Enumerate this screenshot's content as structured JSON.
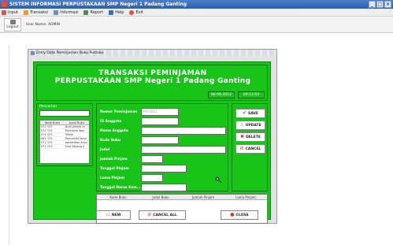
{
  "window": {
    "title": "SISTEM INFORMASI PERPUSTAKAAN SMP Negeri 1 Padang Ganting",
    "buttons": [
      "_",
      "□",
      "×"
    ]
  },
  "menu": {
    "items": [
      {
        "label": "Input",
        "icon": "input-icon",
        "color": "#d9534f"
      },
      {
        "label": "Transaksi",
        "icon": "transaksi-icon",
        "color": "#e0a030"
      },
      {
        "label": "Informasi",
        "icon": "informasi-icon",
        "color": "#6b8cc4"
      },
      {
        "label": "Report",
        "icon": "report-icon",
        "color": "#4a8f4a"
      },
      {
        "label": "Help",
        "icon": "help-icon",
        "color": "#3a6fb8"
      },
      {
        "label": "Exit",
        "icon": "exit-icon",
        "color": "#d9534f"
      }
    ]
  },
  "toolbar": {
    "logout_label": "Logout",
    "user_label": "User Name: ADMIN"
  },
  "internal_frame": {
    "title": "Entry Data Peminjaman Buku Pustaka"
  },
  "header": {
    "line1": "TRANSAKSI PEMINJAMAN",
    "line2": "PERPUSTAKAAN SMP Negeri 1 Padang Ganting",
    "date": "06-06-2012",
    "time": "09:12:03"
  },
  "left_panel": {
    "label": "Pencarian",
    "columns": [
      "Kode Buku",
      "Judul Buku"
    ],
    "rows": [
      [
        "071 '071",
        "Budi pekerti m"
      ],
      [
        "071 '071",
        "Pancasila Idea"
      ],
      [
        "071 '071",
        "Mimbi"
      ],
      [
        "081 '071",
        "Pancasilal Tangi"
      ],
      [
        "071 '071",
        "pendidikan kuny"
      ],
      [
        "071 '071",
        "Dari Sabang S"
      ]
    ]
  },
  "form": {
    "fields": [
      {
        "label": "Nomor Peminjaman",
        "value": "PM-0012"
      },
      {
        "label": "ID Anggota",
        "value": ""
      },
      {
        "label": "Nama Anggota",
        "value": ""
      },
      {
        "label": "Kode Buku",
        "value": ""
      },
      {
        "label": "Judul",
        "value": ""
      },
      {
        "label": "Jumlah Pinjam",
        "value": ""
      },
      {
        "label": "Tanggal Pinjam",
        "value": ""
      },
      {
        "label": "Lama Pinjam",
        "value": ""
      },
      {
        "label": "Tanggal Harus Kem...",
        "value": ""
      }
    ]
  },
  "side_buttons": {
    "save": "SAVE",
    "update": "UPDATE",
    "delete": "DELETE",
    "cancel": "CANCEL"
  },
  "bottom_table": {
    "columns": [
      "Kode Buku",
      "Judul Buku",
      "Jumlah Pinjam",
      "Lama Pinjam"
    ]
  },
  "footer_buttons": {
    "new": "NEW",
    "cancel_all": "CANCEL ALL",
    "close": "CLOSE"
  }
}
